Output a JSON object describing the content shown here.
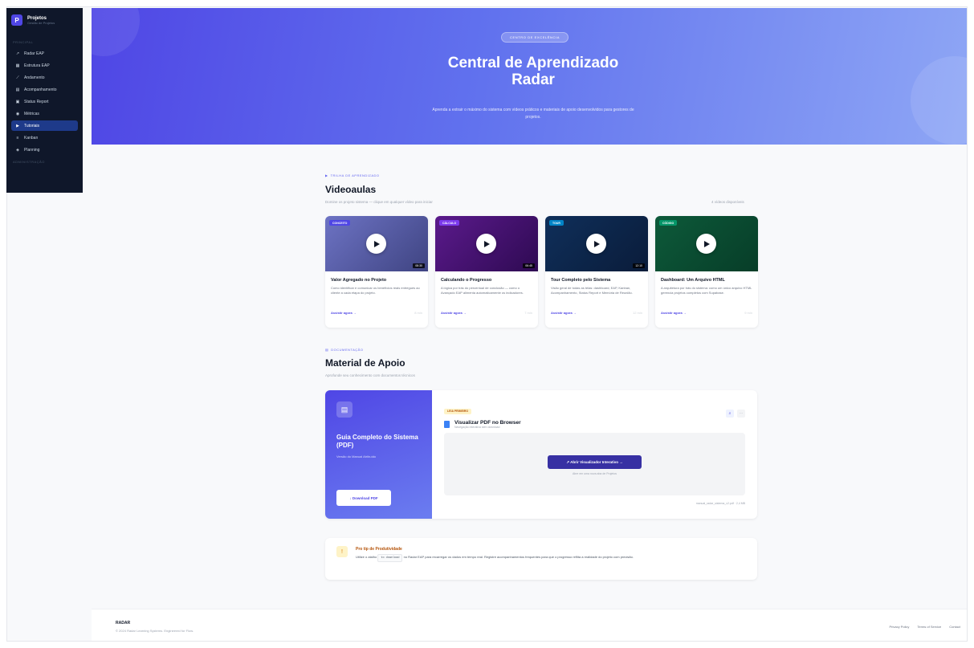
{
  "sidebar": {
    "brand_title": "Projetos",
    "brand_sub": "Gestão de Projetos",
    "section_main": "PRINCIPAL",
    "section_admin": "ADMINISTRAÇÃO",
    "items": [
      {
        "label": "Radar EAP",
        "icon": "chart-icon"
      },
      {
        "label": "Estrutura EAP",
        "icon": "grid-icon"
      },
      {
        "label": "Andamento",
        "icon": "trend-icon"
      },
      {
        "label": "Acompanhamento",
        "icon": "clipboard-icon"
      },
      {
        "label": "Status Report",
        "icon": "report-icon"
      },
      {
        "label": "Métricas",
        "icon": "metrics-icon"
      },
      {
        "label": "Tutoriais",
        "icon": "play-icon"
      },
      {
        "label": "Kanban",
        "icon": "kanban-icon"
      },
      {
        "label": "Planning",
        "icon": "calendar-icon"
      }
    ]
  },
  "hero": {
    "badge": "CENTRO DE EXCELÊNCIA",
    "title_line1": "Central de Aprendizado",
    "title_line2": "Radar",
    "description": "Aprenda a extrair o máximo do sistema com vídeos práticos e materiais de apoio desenvolvidos para gestores de projetos."
  },
  "videos": {
    "kicker": "TRILHA DE APRENDIZADO",
    "title": "Videoaulas",
    "subtitle": "Domine os projeto sistema — clique em qualquer vídeo para iniciar",
    "count": "4 vídeos disponíveis",
    "cards": [
      {
        "tag": "CONCEITO",
        "tag_color": "#4f46e5",
        "duration": "08:30",
        "title": "Valor Agregado no Projeto",
        "desc": "Como identificar e comunicar os benefícios reais entregues ao cliente a cada etapa do projeto.",
        "link": "Assistir agora →",
        "meta": "8 min"
      },
      {
        "tag": "CÁLCULO",
        "tag_color": "#7c3aed",
        "duration": "06:45",
        "title": "Calculando o Progresso",
        "desc": "A lógica por trás do percentual de conclusão — como o Avançado EAP alimenta automaticamente os indicadores.",
        "link": "Assistir agora →",
        "meta": "7 min"
      },
      {
        "tag": "TOUR",
        "tag_color": "#0284c7",
        "duration": "12:10",
        "title": "Tour Completo pelo Sistema",
        "desc": "Visão geral de todas as telas: dashboard, EAP, Kanban, Acompanhamento, Status Report e Memória de Reunião.",
        "link": "Assistir agora →",
        "meta": "12 min"
      },
      {
        "tag": "CÓDIGO",
        "tag_color": "#059669",
        "duration": "",
        "title": "Dashboard: Um Arquivo HTML",
        "desc": "A arquitetura por trás do sistema: como um único arquivo HTML gerencia projetos completos com Supabase.",
        "link": "Assistir agora →",
        "meta": "9 min"
      }
    ]
  },
  "docs": {
    "kicker": "DOCUMENTAÇÃO",
    "title": "Material de Apoio",
    "subtitle": "Aprofunde seu conhecimento com documentos técnicos",
    "guide_title": "Guia Completo do Sistema (PDF)",
    "guide_sub": "Versão do Manual Atribuído",
    "download": "↓ Download PDF",
    "badge": "LEIA PRIMEIRO",
    "pdf_title": "Visualizar PDF no Browser",
    "pdf_sub": "Navegação interativa sem download",
    "open_button": "↗ Abrir Visualizador Interativo →",
    "open_note": "Abre em uma nova aba de Projetos",
    "file_name": "manual_radar_sistema_v2.pdf · 2,4 MB"
  },
  "tip": {
    "title": "Pro tip de Produtividade",
    "text_before": "Utilize o atalho",
    "kbd": "to download",
    "text_after": "no Radar EAP para recarregar os dados em tempo real. Registre acompanhamentos frequentes para que o progresso reflita a realidade do projeto com precisão."
  },
  "footer": {
    "brand": "RADAR",
    "copyright": "© 2024 Radar Learning Systems. Engineered for Flow.",
    "links": [
      "Privacy Policy",
      "Terms of Service",
      "Contact"
    ]
  }
}
